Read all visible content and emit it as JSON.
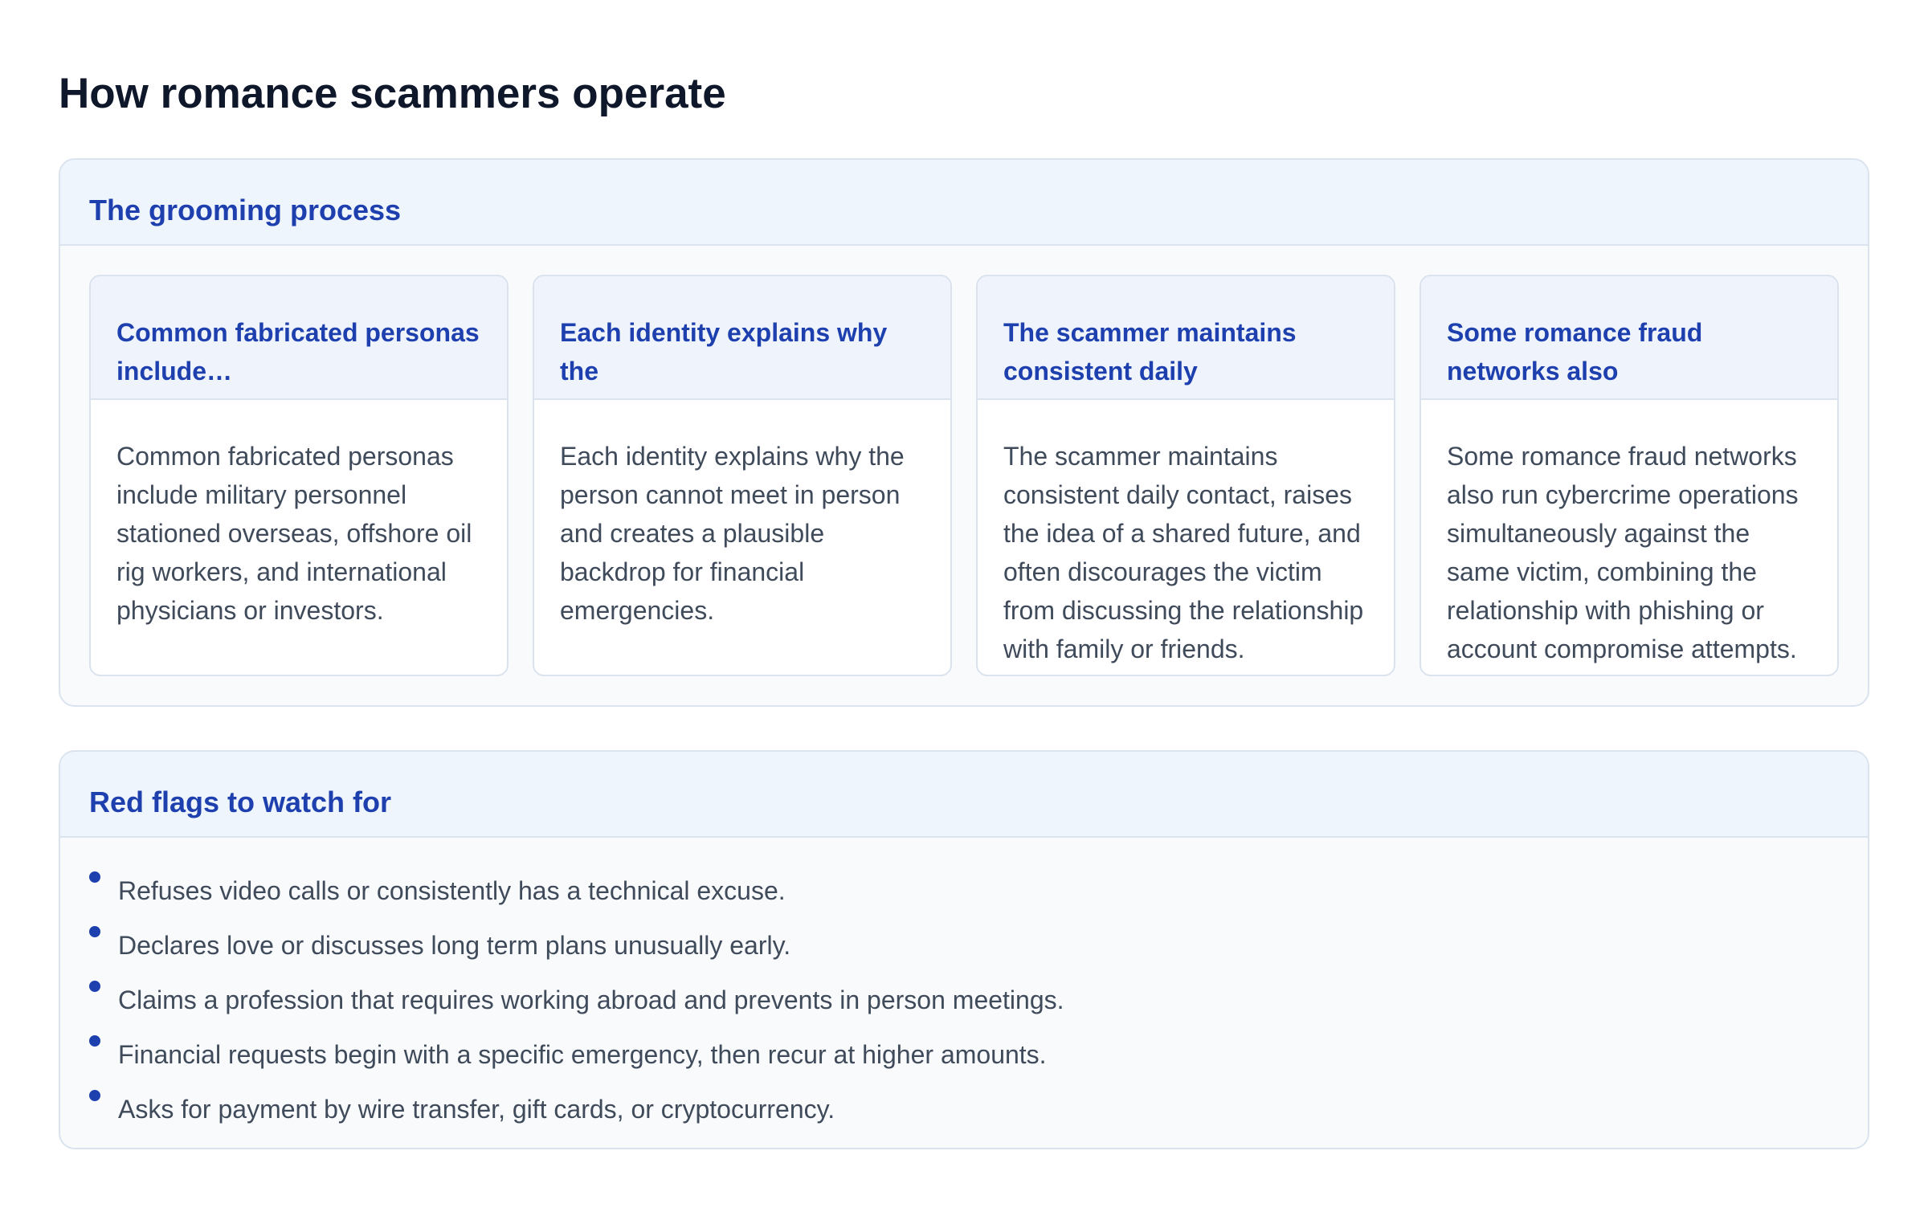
{
  "page": {
    "title": "How romance scammers operate"
  },
  "grooming": {
    "title": "The grooming process",
    "cards": [
      {
        "title": "Common fabricated personas include…",
        "body": "Common fabricated personas include military personnel stationed overseas, offshore oil rig workers, and international physicians or investors."
      },
      {
        "title": "Each identity explains why the",
        "body": "Each identity explains why the person cannot meet in person and creates a plausible backdrop for financial emergencies."
      },
      {
        "title": "The scammer maintains consistent daily",
        "body": "The scammer maintains consistent daily contact, raises the idea of a shared future, and often discourages the victim from discussing the relationship with family or friends."
      },
      {
        "title": "Some romance fraud networks also",
        "body": "Some romance fraud networks also run cybercrime operations simultaneously against the same victim, combining the relationship with phishing or account compromise attempts."
      }
    ]
  },
  "red_flags": {
    "title": "Red flags to watch for",
    "items": [
      "Refuses video calls or consistently has a technical excuse.",
      "Declares love or discusses long term plans unusually early.",
      "Claims a profession that requires working abroad and prevents in person meetings.",
      "Financial requests begin with a specific emergency, then recur at higher amounts.",
      "Asks for payment by wire transfer, gift cards, or cryptocurrency."
    ]
  },
  "colors": {
    "accent": "#1e40af",
    "title": "#0f172a",
    "body_text": "#3f4a5a",
    "panel_header": "#eff5fd",
    "border": "#dbe3ef"
  }
}
